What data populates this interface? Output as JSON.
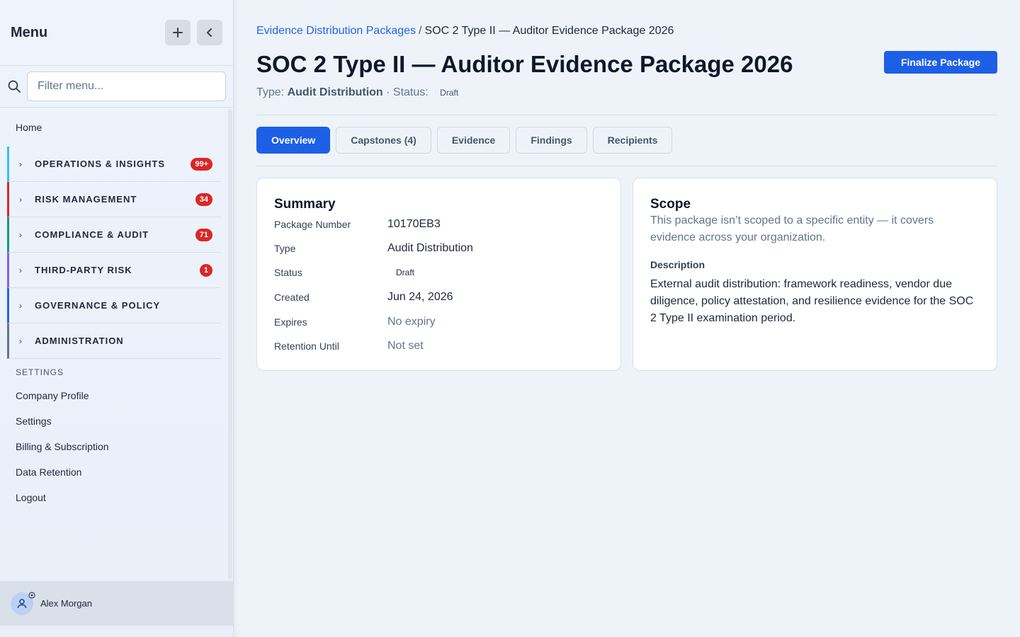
{
  "sidebar": {
    "title": "Menu",
    "search_placeholder": "Filter menu...",
    "home": "Home",
    "groups": [
      {
        "label": "OPERATIONS & INSIGHTS",
        "badge": "99+",
        "color": "#38bdf8"
      },
      {
        "label": "RISK MANAGEMENT",
        "badge": "34",
        "color": "#dc2626"
      },
      {
        "label": "COMPLIANCE & AUDIT",
        "badge": "71",
        "color": "#0f9d78"
      },
      {
        "label": "THIRD-PARTY RISK",
        "badge": "1",
        "color": "#8b5cf6"
      },
      {
        "label": "GOVERNANCE & POLICY",
        "badge": "",
        "color": "#2563eb"
      },
      {
        "label": "ADMINISTRATION",
        "badge": "",
        "color": "#64748b"
      }
    ],
    "settings_section": "SETTINGS",
    "settings_links": [
      "Company Profile",
      "Settings",
      "Billing & Subscription",
      "Data Retention",
      "Logout"
    ],
    "user_name": "Alex Morgan"
  },
  "breadcrumb": {
    "parent": "Evidence Distribution Packages",
    "separator": "/",
    "current": "SOC 2 Type II — Auditor Evidence Package 2026"
  },
  "header": {
    "title": "SOC 2 Type II — Auditor Evidence Package 2026",
    "finalize_label": "Finalize Package",
    "type_prefix": "Type:",
    "type_value": "Audit Distribution",
    "status_prefix": "· Status:",
    "status_value": "Draft"
  },
  "tabs": [
    {
      "label": "Overview",
      "active": true
    },
    {
      "label": "Capstones (4)",
      "active": false
    },
    {
      "label": "Evidence",
      "active": false
    },
    {
      "label": "Findings",
      "active": false
    },
    {
      "label": "Recipients",
      "active": false
    }
  ],
  "summary": {
    "title": "Summary",
    "rows": [
      {
        "key": "Package Number",
        "value": "10170EB3"
      },
      {
        "key": "Type",
        "value": "Audit Distribution"
      },
      {
        "key": "Status",
        "value": "Draft"
      },
      {
        "key": "Created",
        "value": "Jun 24, 2026"
      },
      {
        "key": "Expires",
        "value": "No expiry"
      },
      {
        "key": "Retention Until",
        "value": "Not set"
      }
    ]
  },
  "scope": {
    "title": "Scope",
    "text": "This package isn’t scoped to a specific entity — it covers evidence across your organization.",
    "description_label": "Description",
    "description": "External audit distribution: framework readiness, vendor due diligence, policy attestation, and resilience evidence for the SOC 2 Type II examination period."
  },
  "colors": {
    "accent": "#1d5fe6",
    "badge": "#dc2626"
  }
}
